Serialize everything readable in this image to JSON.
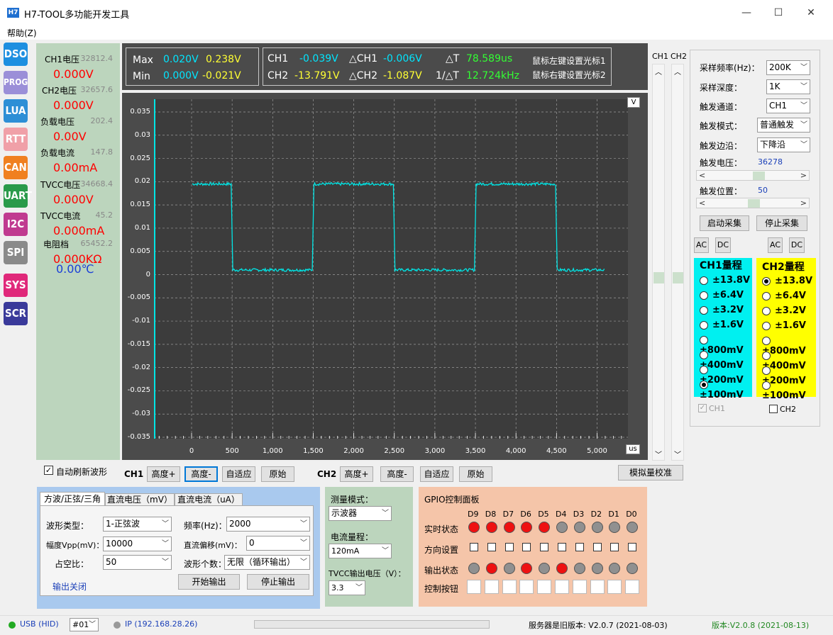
{
  "app": {
    "icon": "H7",
    "title": "H7-TOOL多功能开发工具"
  },
  "window": {
    "minimize": "—",
    "maximize": "☐",
    "close": "✕"
  },
  "menu": {
    "help": "帮助(Z)"
  },
  "nav": [
    {
      "label": "DSO",
      "color": "#1e8fe0"
    },
    {
      "label": "PROG",
      "color": "#9b8fd8"
    },
    {
      "label": "LUA",
      "color": "#2d8fd6"
    },
    {
      "label": "RTT",
      "color": "#f0a0a8"
    },
    {
      "label": "CAN",
      "color": "#f08020"
    },
    {
      "label": "UART",
      "color": "#2a9a4a"
    },
    {
      "label": "I2C",
      "color": "#c03a90"
    },
    {
      "label": "SPI",
      "color": "#8a8a8a"
    },
    {
      "label": "SYS",
      "color": "#e0287a"
    },
    {
      "label": "SCR",
      "color": "#3a3a9a"
    }
  ],
  "measurements": [
    {
      "label": "CH1电压",
      "raw": "32812.4",
      "value": "0.000V"
    },
    {
      "label": "CH2电压",
      "raw": "32657.6",
      "value": "0.000V"
    },
    {
      "label": "负载电压",
      "raw": "202.4",
      "value": "0.00V"
    },
    {
      "label": "负载电流",
      "raw": "147.8",
      "value": "0.00mA"
    },
    {
      "label": "TVCC电压",
      "raw": "34668.4",
      "value": "0.000V"
    },
    {
      "label": "TVCC电流",
      "raw": "45.2",
      "value": "0.000mA"
    },
    {
      "label": "电阻档",
      "raw": "65452.2",
      "value": "0.000KΩ"
    }
  ],
  "temperature": "0.00℃",
  "stats": {
    "max_label": "Max",
    "min_label": "Min",
    "max_ch1": "0.020V",
    "max_ch2": "0.238V",
    "min_ch1": "0.000V",
    "min_ch2": "-0.021V",
    "ch1_label": "CH1",
    "ch2_label": "CH2",
    "ch1": "-0.039V",
    "ch2": "-13.791V",
    "dch1_label": "△CH1",
    "dch2_label": "△CH2",
    "dch1": "-0.006V",
    "dch2": "-1.087V",
    "dt_label": "△T",
    "inv_dt_label": "1/△T",
    "dt": "78.589us",
    "inv_dt": "12.724kHz",
    "hint1": "鼠标左键设置光标1",
    "hint2": "鼠标右键设置光标2"
  },
  "scope": {
    "y_unit": "V",
    "x_unit": "us",
    "y_ticks": [
      "0.035",
      "0.03",
      "0.025",
      "0.02",
      "0.015",
      "0.01",
      "0.005",
      "0",
      "-0.005",
      "-0.01",
      "-0.015",
      "-0.02",
      "-0.025",
      "-0.03",
      "-0.035"
    ],
    "x_ticks": [
      "0",
      "500",
      "1,000",
      "1,500",
      "2,000",
      "2,500",
      "3,000",
      "3,500",
      "4,000",
      "4,500",
      "5,000"
    ],
    "trace_color": "#00e5e5",
    "square_wave": {
      "high": 0.0195,
      "low": 0.001,
      "edges_us": [
        0,
        500,
        1500,
        2500,
        3500,
        4500,
        5100
      ]
    }
  },
  "scroll_labels": {
    "ch1": "CH1",
    "ch2": "CH2"
  },
  "controls": {
    "auto_refresh": "自动刷新波形",
    "ch1": "CH1",
    "ch2": "CH2",
    "height_plus": "高度+",
    "height_minus": "高度-",
    "auto_fit": "自适应",
    "original": "原始",
    "calibrate": "模拟量校准"
  },
  "right": {
    "sample_rate_label": "采样频率(Hz)：",
    "sample_rate": "200K",
    "sample_depth_label": "采样深度：",
    "sample_depth": "1K",
    "trig_channel_label": "触发通道：",
    "trig_channel": "CH1",
    "trig_mode_label": "触发模式：",
    "trig_mode": "普通触发",
    "trig_edge_label": "触发边沿：",
    "trig_edge": "下降沿",
    "trig_voltage_label": "触发电压：",
    "trig_voltage": "36278",
    "trig_pos_label": "触发位置：",
    "trig_pos": "50",
    "start": "启动采集",
    "stop": "停止采集",
    "ac": "AC",
    "dc": "DC",
    "ch1_range_title": "CH1量程",
    "ch2_range_title": "CH2量程",
    "ranges": [
      "±13.8V",
      "±6.4V",
      "±3.2V",
      "±1.6V",
      "±800mV",
      "±400mV",
      "±200mV",
      "±100mV"
    ],
    "ch1_selected": "±100mV",
    "ch2_selected": "±13.8V",
    "ch1_check": "CH1",
    "ch2_check": "CH2"
  },
  "funcgen": {
    "tabs": [
      "方波/正弦/三角",
      "直流电压（mV）",
      "直流电流（uA）"
    ],
    "wave_type_label": "波形类型：",
    "wave_type": "1-正弦波",
    "freq_label": "频率(Hz)：",
    "freq": "2000",
    "amp_label": "幅度Vpp(mV)：",
    "amp": "10000",
    "offset_label": "直流偏移(mV)：",
    "offset": "0",
    "duty_label": "占空比：",
    "duty": "50",
    "count_label": "波形个数：",
    "count": "无限（循环输出）",
    "status": "输出关闭",
    "start": "开始输出",
    "stop": "停止输出"
  },
  "measmode": {
    "mode_label": "测量模式：",
    "mode": "示波器",
    "current_range_label": "电流量程：",
    "current_range": "120mA",
    "tvcc_label": "TVCC输出电压（V）：",
    "tvcc": "3.3"
  },
  "gpio": {
    "title": "GPIO控制面板",
    "pins": [
      "D9",
      "D8",
      "D7",
      "D6",
      "D5",
      "D4",
      "D3",
      "D2",
      "D1",
      "D0"
    ],
    "realtime_label": "实时状态",
    "direction_label": "方向设置",
    "output_label": "输出状态",
    "control_label": "控制按钮",
    "realtime": [
      1,
      1,
      1,
      1,
      1,
      0,
      0,
      0,
      0,
      0
    ],
    "output": [
      0,
      1,
      0,
      1,
      0,
      1,
      0,
      0,
      0,
      0
    ]
  },
  "status": {
    "usb": "USB (HID)",
    "device": "#01",
    "ip": "IP (192.168.28.26)",
    "server": "服务器是旧版本: V2.0.7 (2021-08-03)",
    "version": "版本:V2.0.8 (2021-08-13)"
  }
}
